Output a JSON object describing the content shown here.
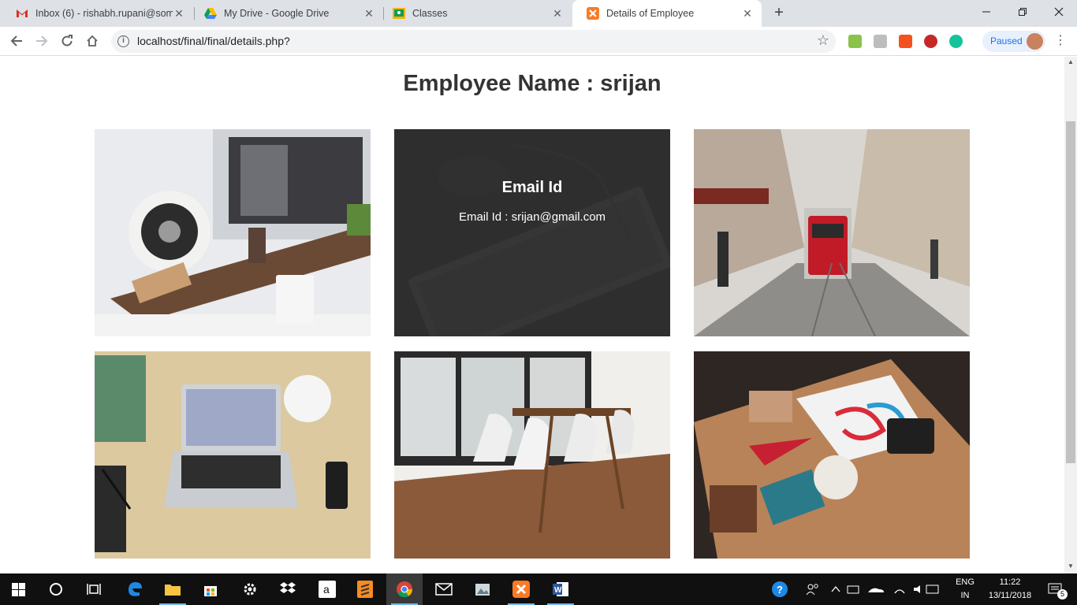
{
  "browser": {
    "tabs": [
      {
        "label": "Inbox (6) - rishabh.rupani@soma",
        "icon": "gmail-icon",
        "active": false
      },
      {
        "label": "My Drive - Google Drive",
        "icon": "google-drive-icon",
        "active": false
      },
      {
        "label": "Classes",
        "icon": "classroom-icon",
        "active": false
      },
      {
        "label": "Details of Employee",
        "icon": "xampp-icon",
        "active": true
      }
    ],
    "url": "localhost/final/final/details.php?",
    "profile_status": "Paused"
  },
  "page": {
    "title": "Employee Name : srijan",
    "cards": [
      {
        "image": "desk-speaker-photo"
      },
      {
        "image": "keyboard-photo",
        "overlay_title": "Email Id",
        "overlay_text": "Email Id : srijan@gmail.com"
      },
      {
        "image": "street-tram-photo"
      },
      {
        "image": "laptop-desk-photo"
      },
      {
        "image": "dining-chairs-photo"
      },
      {
        "image": "craft-table-photo"
      }
    ]
  },
  "taskbar": {
    "language": "ENG",
    "region": "IN",
    "time": "11:22",
    "date": "13/11/2018",
    "notifications": "5"
  },
  "colors": {
    "accent": "#1a73e8",
    "title_text": "#333333",
    "overlay": "#282828"
  }
}
